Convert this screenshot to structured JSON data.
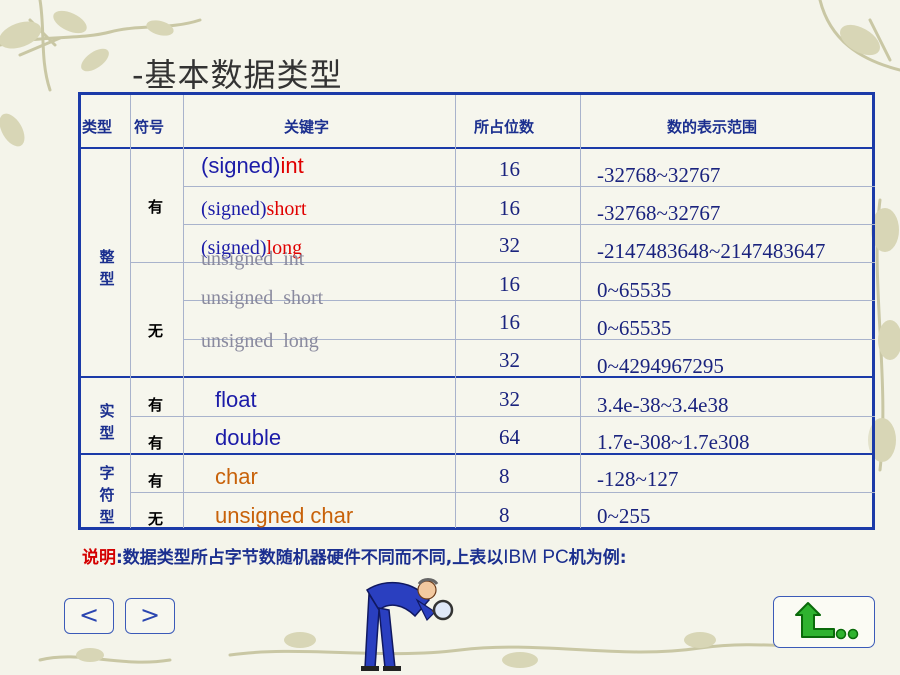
{
  "title": "-基本数据类型",
  "colors": {
    "border": "#1b3aa8",
    "keyword_red": "#e00000",
    "keyword_gray": "#8a8a9e",
    "keyword_orange": "#c8620a",
    "keyword_blue": "#1c1ca8"
  },
  "table": {
    "headers": {
      "type": "类型",
      "sign": "符号",
      "keyword": "关键字",
      "bits": "所占位数",
      "range": "数的表示范围"
    },
    "groups": {
      "integer": "整型",
      "real": "实型",
      "char": "字符型"
    },
    "signs": {
      "signed": "有",
      "unsigned": "无"
    },
    "rows": [
      {
        "prefix": "(signed)",
        "kw": "int",
        "bits": "16",
        "range": "-32768~32767"
      },
      {
        "prefix": "(signed)",
        "kw": "short",
        "bits": "16",
        "range": "-32768~32767"
      },
      {
        "prefix": "(signed)",
        "kw": "long",
        "bits": "32",
        "range": "-2147483648~2147483647"
      },
      {
        "prefix": "",
        "kw": "unsigned  int",
        "bits": "16",
        "range": "0~65535"
      },
      {
        "prefix": "",
        "kw": "unsigned  short",
        "bits": "16",
        "range": "0~65535"
      },
      {
        "prefix": "",
        "kw": "unsigned  long",
        "bits": "32",
        "range": "0~4294967295"
      },
      {
        "prefix": "",
        "kw": "float",
        "bits": "32",
        "range": "3.4e-38~3.4e38"
      },
      {
        "prefix": "",
        "kw": "double",
        "bits": "64",
        "range": "1.7e-308~1.7e308"
      },
      {
        "prefix": "",
        "kw": "char",
        "bits": "8",
        "range": "-128~127"
      },
      {
        "prefix": "",
        "kw": "unsigned char",
        "bits": "8",
        "range": "0~255"
      }
    ]
  },
  "note": {
    "label": "说明",
    "text_a": ":数据类型所占字节数随机器硬件不同而不同,上表以",
    "text_ibm": "IBM PC",
    "text_b": "机为例:"
  },
  "nav": {
    "prev": "<",
    "next": ">"
  },
  "icons": {
    "return": "return-arrow-icon",
    "cartoon": "magnifier-man-icon",
    "decor": "vine-icon"
  }
}
